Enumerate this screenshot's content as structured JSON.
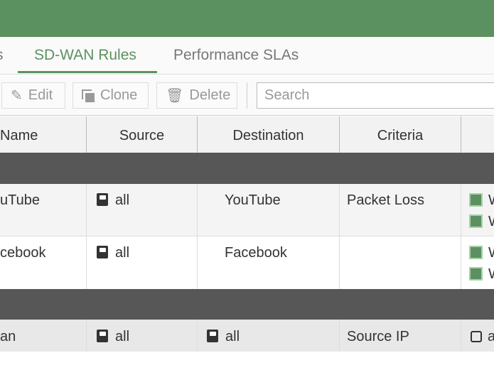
{
  "tabs": [
    {
      "label": "s"
    },
    {
      "label": "SD-WAN Rules",
      "active": true
    },
    {
      "label": "Performance SLAs"
    }
  ],
  "toolbar": {
    "edit": "Edit",
    "clone": "Clone",
    "delete": "Delete",
    "search_placeholder": "Search"
  },
  "columns": [
    "Name",
    "Source",
    "Destination",
    "Criteria"
  ],
  "rows": [
    {
      "name": "uTube",
      "source": "all",
      "destination": "YouTube",
      "criteria": "Packet Loss",
      "members": [
        "W",
        "W"
      ]
    },
    {
      "name": "cebook",
      "source": "all",
      "destination": "Facebook",
      "criteria": "",
      "members": [
        "W",
        "W"
      ]
    },
    {
      "name": "an",
      "source": "all",
      "destination": "all",
      "criteria": "Source IP",
      "members": [
        "a"
      ]
    }
  ],
  "colors": {
    "brand": "#5b9160",
    "group_row": "#575757"
  }
}
